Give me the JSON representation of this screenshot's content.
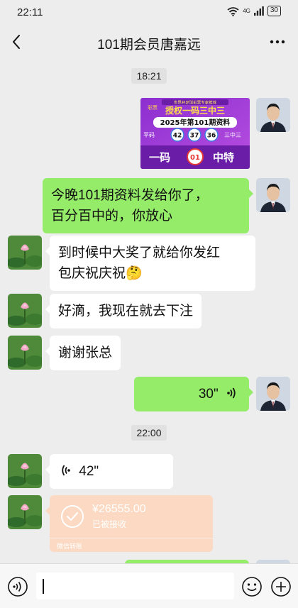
{
  "status_bar": {
    "time": "22:11",
    "network": "4G",
    "battery": "30"
  },
  "header": {
    "title": "101期会员唐嘉远"
  },
  "messages": {
    "time_1": "18:21",
    "promo": {
      "top_line": "世界杯足球彩票专家推荐",
      "logo": "彩票",
      "slogan": "授权一码三中三",
      "subtitle": "2025年第101期资料",
      "left_tag": "平码",
      "numbers": [
        "42",
        "37",
        "36"
      ],
      "right_tag": "三中三",
      "special_left": "一码",
      "special_number": "01",
      "special_right": "中特"
    },
    "m1_line1": "今晚101期资料发给你了，",
    "m1_line2": "百分百中的，你放心",
    "m2_line1": "到时候中大奖了就给你发红",
    "m2_line2": "包庆祝庆祝",
    "m2_emoji": "🤔",
    "m3": "好滴，我现在就去下注",
    "m4": "谢谢张总",
    "voice_out": "30\"",
    "time_2": "22:00",
    "voice_in": "42\"",
    "red_packet": {
      "amount": "¥26555.00",
      "status": "已被接收",
      "footer": "微信转账"
    }
  },
  "colors": {
    "outgoing": "#95ec69",
    "incoming": "#ffffff",
    "background": "#ededed",
    "transfer": "#fbd9c2"
  },
  "icons": [
    "back-arrow-icon",
    "more-icon",
    "wifi-icon",
    "signal-icon",
    "voice-wave-icon",
    "check-circle-icon",
    "voice-input-icon",
    "emoji-icon",
    "plus-icon"
  ]
}
